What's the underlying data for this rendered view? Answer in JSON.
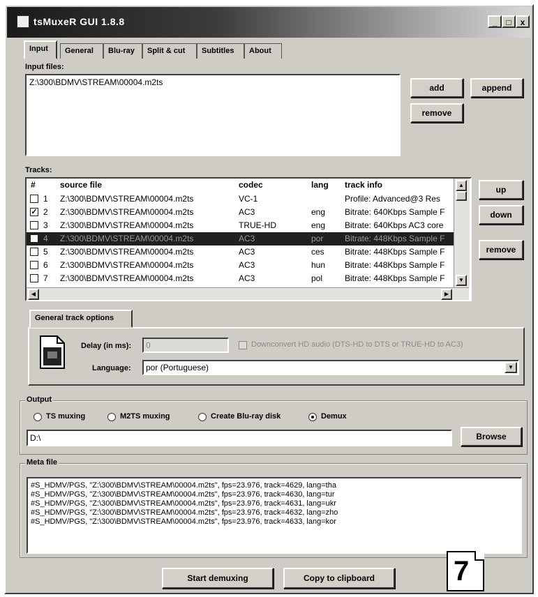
{
  "window": {
    "title": "tsMuxeR GUI 1.8.8",
    "controls": {
      "minimize": "_",
      "maximize": "□",
      "close": "x"
    }
  },
  "tabs": [
    "Input",
    "General",
    "Blu-ray",
    "Split & cut",
    "Subtitles",
    "About"
  ],
  "input": {
    "label": "Input files:",
    "files": [
      "Z:\\300\\BDMV\\STREAM\\00004.m2ts"
    ],
    "add": "add",
    "append": "append",
    "remove": "remove"
  },
  "tracks": {
    "label": "Tracks:",
    "columns": [
      "#",
      "source file",
      "codec",
      "lang",
      "track info"
    ],
    "rows": [
      {
        "num": "1",
        "checked": false,
        "file": "Z:\\300\\BDMV\\STREAM\\00004.m2ts",
        "codec": "VC-1",
        "lang": "",
        "info": "Profile: Advanced@3 Res"
      },
      {
        "num": "2",
        "checked": true,
        "file": "Z:\\300\\BDMV\\STREAM\\00004.m2ts",
        "codec": "AC3",
        "lang": "eng",
        "info": "Bitrate: 640Kbps Sample F"
      },
      {
        "num": "3",
        "checked": false,
        "file": "Z:\\300\\BDMV\\STREAM\\00004.m2ts",
        "codec": "TRUE-HD",
        "lang": "eng",
        "info": "Bitrate: 640Kbps AC3 core"
      },
      {
        "num": "4",
        "checked": false,
        "file": "Z:\\300\\BDMV\\STREAM\\00004.m2ts",
        "codec": "AC3",
        "lang": "por",
        "info": "Bitrate: 448Kbps Sample F",
        "selected": true
      },
      {
        "num": "5",
        "checked": false,
        "file": "Z:\\300\\BDMV\\STREAM\\00004.m2ts",
        "codec": "AC3",
        "lang": "ces",
        "info": "Bitrate: 448Kbps Sample F"
      },
      {
        "num": "6",
        "checked": false,
        "file": "Z:\\300\\BDMV\\STREAM\\00004.m2ts",
        "codec": "AC3",
        "lang": "hun",
        "info": "Bitrate: 448Kbps Sample F"
      },
      {
        "num": "7",
        "checked": false,
        "file": "Z:\\300\\BDMV\\STREAM\\00004.m2ts",
        "codec": "AC3",
        "lang": "pol",
        "info": "Bitrate: 448Kbps Sample F"
      }
    ],
    "up": "up",
    "down": "down",
    "remove": "remove"
  },
  "track_options": {
    "tab": "General track options",
    "delay_label": "Delay (in ms):",
    "delay_value": "0",
    "downconvert": "Downconvert HD audio (DTS-HD to DTS or TRUE-HD to AC3)",
    "language_label": "Language:",
    "language_value": "por (Portuguese)"
  },
  "output": {
    "legend": "Output",
    "options": [
      "TS muxing",
      "M2TS muxing",
      "Create Blu-ray disk",
      "Demux"
    ],
    "selected": "Demux",
    "path": "D:\\",
    "browse": "Browse"
  },
  "meta": {
    "legend": "Meta file",
    "lines": [
      "#S_HDMV/PGS, \"Z:\\300\\BDMV\\STREAM\\00004.m2ts\", fps=23.976, track=4629, lang=tha",
      "#S_HDMV/PGS, \"Z:\\300\\BDMV\\STREAM\\00004.m2ts\", fps=23.976, track=4630, lang=tur",
      "#S_HDMV/PGS, \"Z:\\300\\BDMV\\STREAM\\00004.m2ts\", fps=23.976, track=4631, lang=ukr",
      "#S_HDMV/PGS, \"Z:\\300\\BDMV\\STREAM\\00004.m2ts\", fps=23.976, track=4632, lang=zho",
      "#S_HDMV/PGS, \"Z:\\300\\BDMV\\STREAM\\00004.m2ts\", fps=23.976, track=4633, lang=kor"
    ]
  },
  "actions": {
    "start": "Start demuxing",
    "copy": "Copy to clipboard"
  },
  "badge": "7"
}
